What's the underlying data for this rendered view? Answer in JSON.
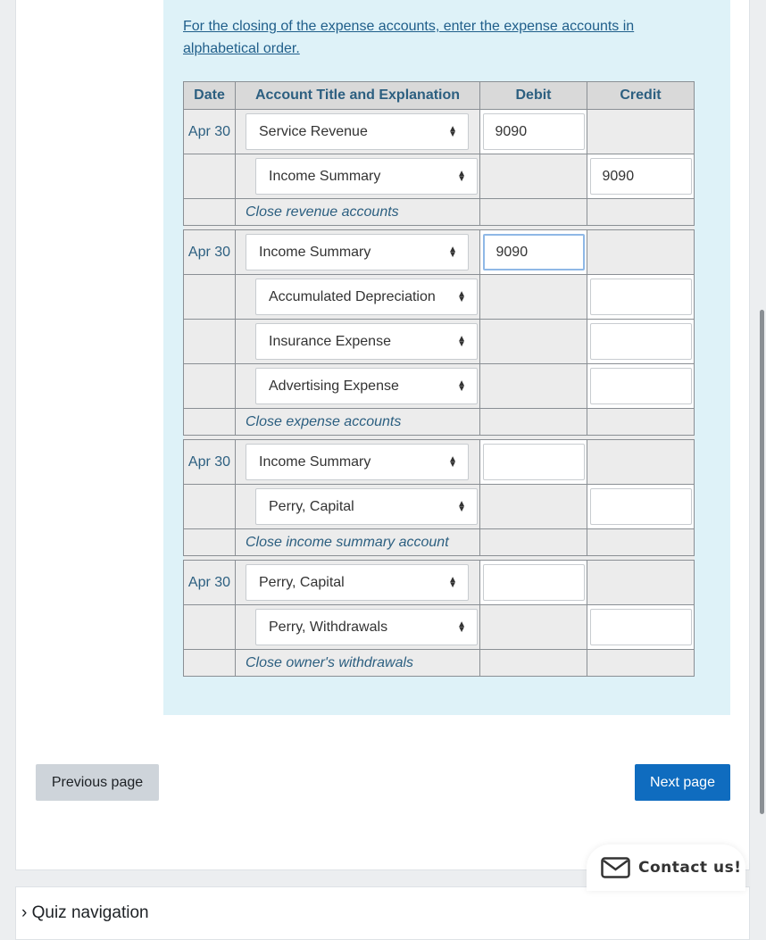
{
  "instruction": "For the closing of the expense accounts, enter the expense accounts in alphabetical order.",
  "table": {
    "headers": [
      "Date",
      "Account Title and Explanation",
      "Debit",
      "Credit"
    ],
    "entries": [
      {
        "date": "Apr 30",
        "debit_account": "Service Revenue",
        "debit_amount": "9090",
        "credits": [
          {
            "account": "Income Summary",
            "amount": "9090"
          }
        ],
        "explanation": "Close revenue accounts"
      },
      {
        "date": "Apr 30",
        "debit_account": "Income Summary",
        "debit_amount": "9090",
        "credits": [
          {
            "account": "Accumulated Depreciation",
            "amount": ""
          },
          {
            "account": "Insurance Expense",
            "amount": ""
          },
          {
            "account": "Advertising Expense",
            "amount": ""
          }
        ],
        "explanation": "Close expense accounts"
      },
      {
        "date": "Apr 30",
        "debit_account": "Income Summary",
        "debit_amount": "",
        "credits": [
          {
            "account": "Perry, Capital",
            "amount": ""
          }
        ],
        "explanation": "Close income summary account"
      },
      {
        "date": "Apr 30",
        "debit_account": "Perry, Capital",
        "debit_amount": "",
        "credits": [
          {
            "account": "Perry, Withdrawals",
            "amount": ""
          }
        ],
        "explanation": "Close owner's withdrawals"
      }
    ]
  },
  "nav": {
    "previous_label": "Previous page",
    "next_label": "Next page"
  },
  "contact": {
    "label": "Contact us!"
  },
  "quiz_navigation": {
    "label": "Quiz navigation"
  },
  "colors": {
    "accent": "#0f6cbf",
    "panel": "#def2f8"
  }
}
